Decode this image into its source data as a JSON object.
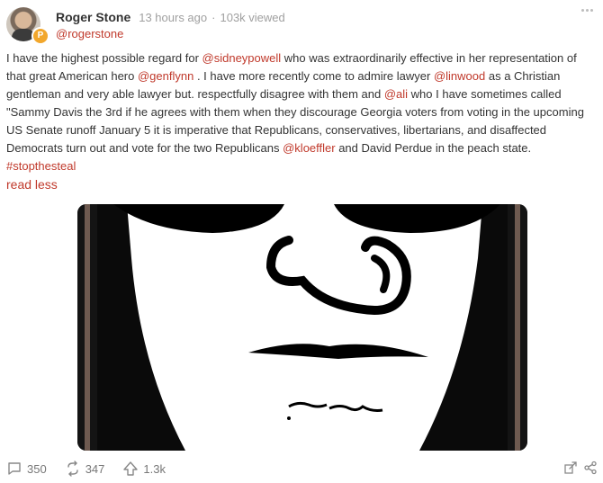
{
  "author": {
    "name": "Roger Stone",
    "time_ago": "13 hours ago",
    "separator": "·",
    "views": "103k viewed",
    "handle": "@rogerstone",
    "badge_letter": "P"
  },
  "post": {
    "segments": [
      {
        "text": "I have the highest possible regard for ",
        "mention": false
      },
      {
        "text": "@sidneypowell",
        "mention": true
      },
      {
        "text": " who was extraordinarily effective in her representation of that great American hero ",
        "mention": false
      },
      {
        "text": "@genflynn",
        "mention": true
      },
      {
        "text": " . I have more recently come to admire lawyer ",
        "mention": false
      },
      {
        "text": "@linwood",
        "mention": true
      },
      {
        "text": " as a Christian gentleman and very able lawyer but. respectfully disagree with them and ",
        "mention": false
      },
      {
        "text": "@ali",
        "mention": true
      },
      {
        "text": " who I have sometimes called \"Sammy Davis the 3rd if he agrees with them when they discourage Georgia voters from voting in the upcoming US Senate runoff January 5 it is imperative that Republicans, conservatives, libertarians, and disaffected Democrats turn out and vote for the two Republicans ",
        "mention": false
      },
      {
        "text": "@kloeffler",
        "mention": true
      },
      {
        "text": " and David Perdue in the peach state. ",
        "mention": false
      },
      {
        "text": "#stopthesteal",
        "mention": true
      }
    ],
    "read_less": "read less"
  },
  "actions": {
    "comments": "350",
    "reposts": "347",
    "upvotes": "1.3k"
  },
  "icons": {
    "comment": "comment-icon",
    "repost": "repost-icon",
    "upvote": "upvote-icon",
    "quote": "quote-icon",
    "share": "share-icon",
    "more": "more-icon"
  },
  "colors": {
    "accent": "#c0392b",
    "badge": "#f2a72c",
    "muted": "#a0a0a0"
  }
}
